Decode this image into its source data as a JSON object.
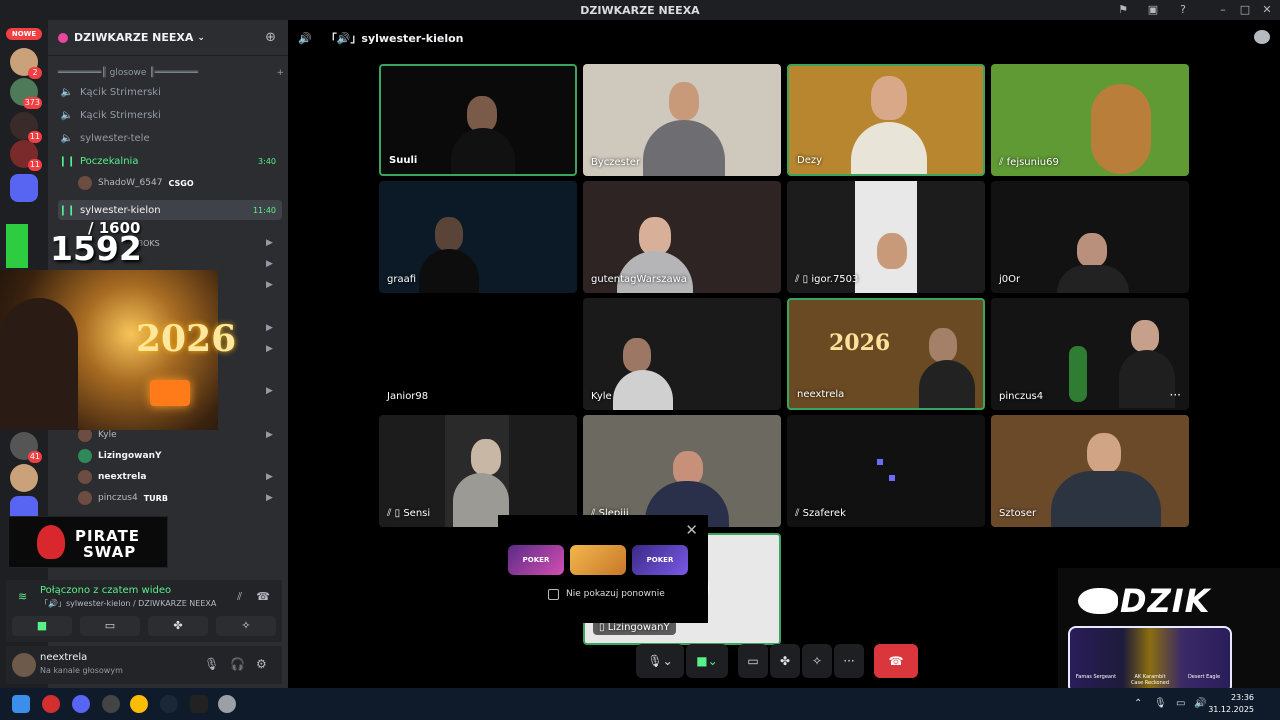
{
  "window": {
    "title": "DZIWKARZE NEEXA"
  },
  "server_rail": {
    "new_badge": "NOWE",
    "badges": [
      "2",
      "373",
      "11",
      "11",
      "41"
    ]
  },
  "sidebar": {
    "guild_name": "DZIWKARZE NEEXA",
    "category": "════════║ glosowe ║════════",
    "channels": [
      {
        "label": "Kącik Strimerski",
        "locked": true
      },
      {
        "label": "Kącik Strimerski",
        "locked": true
      },
      {
        "label": "sylwester-tele",
        "locked": false
      },
      {
        "label": "Poczekalnia",
        "time": "3:40"
      },
      {
        "label": "sylwester-kielon",
        "time": "11:40"
      }
    ],
    "poczekalnia_member": {
      "name": "ShadoW_6547",
      "tag": "CSGO"
    },
    "members": [
      {
        "name": "Kyle"
      },
      {
        "name": "LizingowanY"
      },
      {
        "name": "neextrela"
      },
      {
        "name": "pinczus4",
        "tag": "TURB"
      }
    ],
    "partial_member": "3OKS"
  },
  "overlay": {
    "counter_sub": "/ 1600",
    "counter": "1592",
    "year": "2026",
    "sponsor_line1": "PIRATE",
    "sponsor_line2": "SWAP"
  },
  "voice_panel": {
    "status": "Połączono z czatem wideo",
    "location": "「🔊」sylwester-kielon / DZIWKARZE NEEXA"
  },
  "user": {
    "name": "neextrela",
    "status": "Na kanale głosowym"
  },
  "main": {
    "channel_title": "「🔊」sylwester-kielon",
    "tiles": [
      {
        "name": "Suuli",
        "speaking": true,
        "muted": false
      },
      {
        "name": "Byczester",
        "speaking": false,
        "muted": false
      },
      {
        "name": "Dezy",
        "speaking": true,
        "muted": false
      },
      {
        "name": "fejsuniu69",
        "speaking": false,
        "muted": true
      },
      {
        "name": "graafi",
        "speaking": false,
        "muted": false
      },
      {
        "name": "gutentagWarszawa",
        "speaking": false,
        "muted": false
      },
      {
        "name": "igor.7503",
        "speaking": false,
        "muted": true
      },
      {
        "name": "j0Or",
        "speaking": false,
        "muted": false
      },
      {
        "name": "Janior98",
        "speaking": false,
        "muted": false
      },
      {
        "name": "Kyle",
        "speaking": false,
        "muted": false
      },
      {
        "name": "neextrela",
        "speaking": true,
        "muted": false
      },
      {
        "name": "pinczus4",
        "speaking": false,
        "muted": false
      },
      {
        "name": "Sensi",
        "speaking": false,
        "muted": true
      },
      {
        "name": "Slepiii",
        "speaking": false,
        "muted": true
      },
      {
        "name": "Szaferek",
        "speaking": false,
        "muted": true
      },
      {
        "name": "Sztoser",
        "speaking": false,
        "muted": false
      },
      {
        "name": "LizingowanY",
        "speaking": true,
        "muted": false
      }
    ]
  },
  "activity_popup": {
    "checkbox_label": "Nie pokazuj ponownie",
    "cards": [
      "POKER",
      "",
      "POKER"
    ]
  },
  "dzik": {
    "brand": "DZIK",
    "cases": [
      "Famas Sergeant",
      "AK Karambit Case Reckoned",
      "Desert Eagle"
    ]
  },
  "taskbar": {
    "time": "23:36",
    "date": "31.12.2025"
  },
  "colors": {
    "accent_green": "#3ba55d",
    "end_call": "#da373c",
    "discord_bg": "#2b2d31"
  }
}
